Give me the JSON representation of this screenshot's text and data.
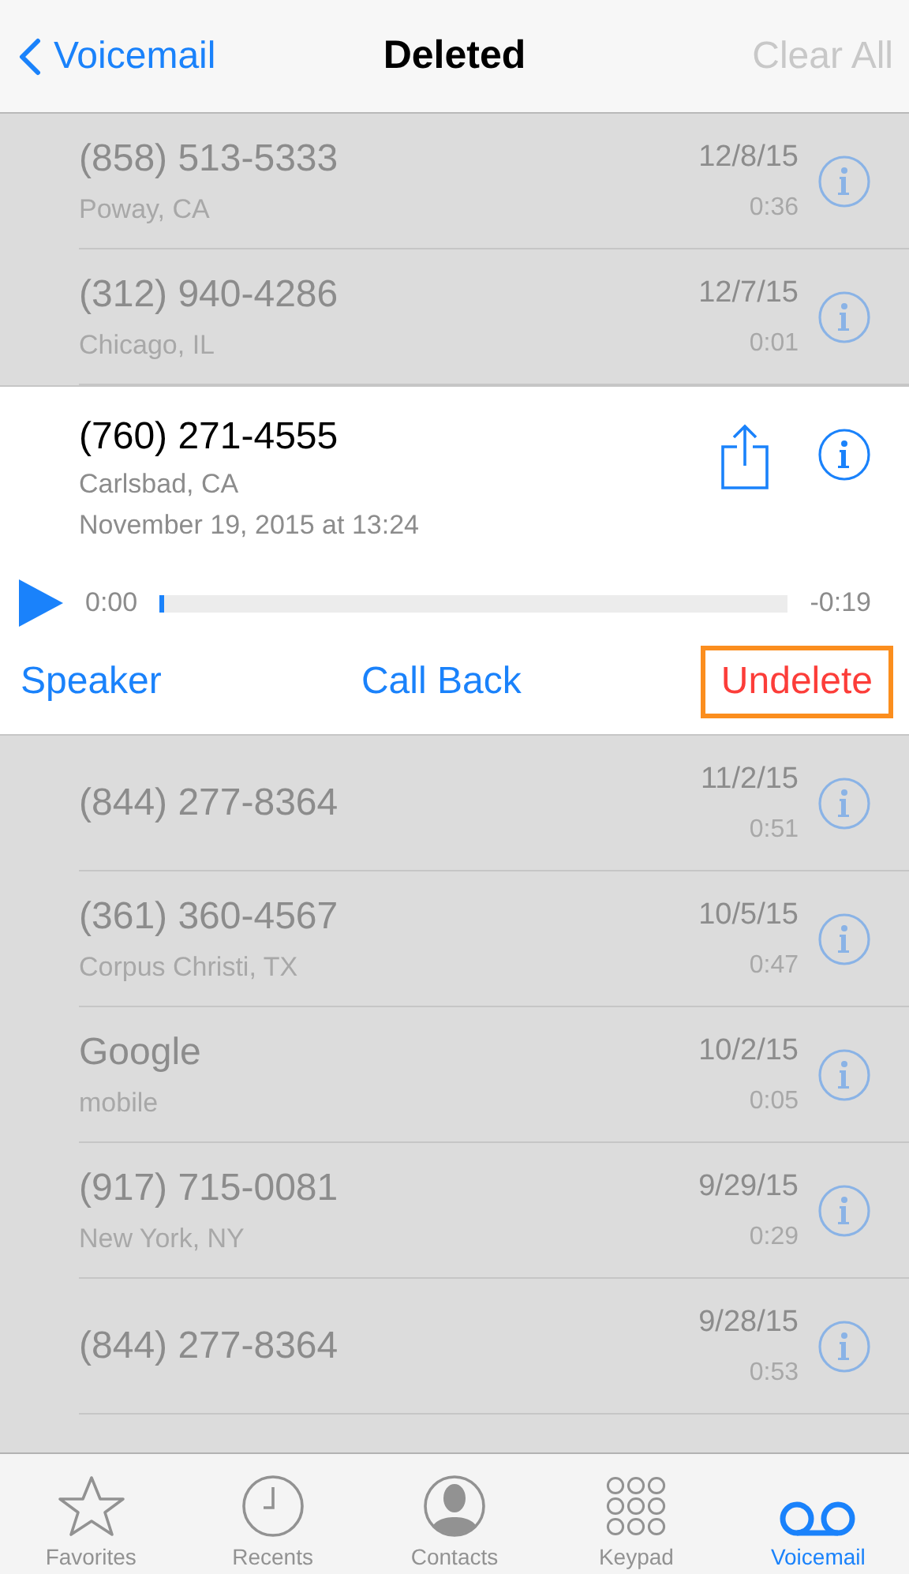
{
  "nav": {
    "back": "Voicemail",
    "title": "Deleted",
    "action": {
      "label": "Clear All",
      "disabled": true
    }
  },
  "voicemails": [
    {
      "kind": "collapsed",
      "number": "(858) 513-5333",
      "location": "Poway, CA",
      "date": "12/8/15",
      "duration": "0:36"
    },
    {
      "kind": "collapsed",
      "number": "(312) 940-4286",
      "location": "Chicago, IL",
      "date": "12/7/15",
      "duration": "0:01"
    },
    {
      "kind": "expanded",
      "number": "(760) 271-4555",
      "location": "Carlsbad, CA",
      "timestamp": "November 19, 2015 at 13:24",
      "elapsed": "0:00",
      "remaining": "-0:19",
      "level": 0,
      "actions": [
        {
          "label": "Speaker",
          "kind": "normal",
          "highlighted": false
        },
        {
          "label": "Call Back",
          "kind": "normal",
          "highlighted": false
        },
        {
          "label": "Undelete",
          "kind": "destructive",
          "highlighted": true
        }
      ]
    },
    {
      "kind": "collapsed",
      "number": "(844) 277-8364",
      "date": "11/2/15",
      "duration": "0:51"
    },
    {
      "kind": "collapsed",
      "number": "(361) 360-4567",
      "location": "Corpus Christi, TX",
      "date": "10/5/15",
      "duration": "0:47"
    },
    {
      "kind": "collapsed",
      "number": "Google",
      "location": "mobile",
      "date": "10/2/15",
      "duration": "0:05"
    },
    {
      "kind": "collapsed",
      "number": "(917) 715-0081",
      "location": "New York, NY",
      "date": "9/29/15",
      "duration": "0:29"
    },
    {
      "kind": "collapsed",
      "number": "(844) 277-8364",
      "date": "9/28/15",
      "duration": "0:53"
    }
  ],
  "tabs": [
    {
      "label": "Favorites",
      "selected": false
    },
    {
      "label": "Recents",
      "selected": false
    },
    {
      "label": "Contacts",
      "selected": false
    },
    {
      "label": "Keypad",
      "selected": false
    },
    {
      "label": "Voicemail",
      "selected": true
    }
  ]
}
